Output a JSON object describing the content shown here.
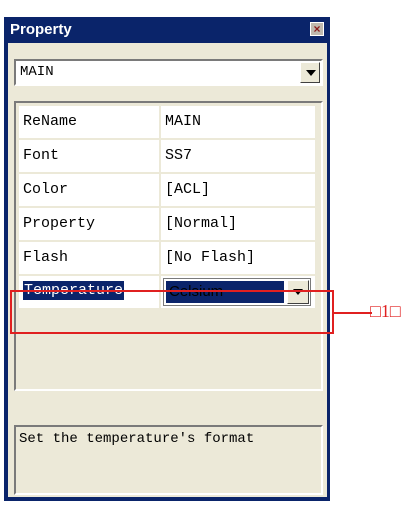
{
  "window": {
    "title": "Property",
    "close_glyph": "×"
  },
  "selector": {
    "value": "MAIN"
  },
  "properties": [
    {
      "name": "ReName",
      "value": "MAIN"
    },
    {
      "name": "Font",
      "value": "SS7"
    },
    {
      "name": "Color",
      "value": "[ACL]"
    },
    {
      "name": "Property",
      "value": "[Normal]"
    },
    {
      "name": "Flash",
      "value": "[No Flash]"
    }
  ],
  "temperature_row": {
    "name": "Temperature",
    "value": "Celsium"
  },
  "description": "Set the temperature's format",
  "annotation": {
    "label": "□1□"
  },
  "colors": {
    "title_bar": "#0a246a",
    "panel": "#ece9d8",
    "highlight": "#0a246a",
    "callout": "#e02020"
  },
  "icons": {
    "close": "close-icon",
    "dropdown": "chevron-down-icon"
  }
}
